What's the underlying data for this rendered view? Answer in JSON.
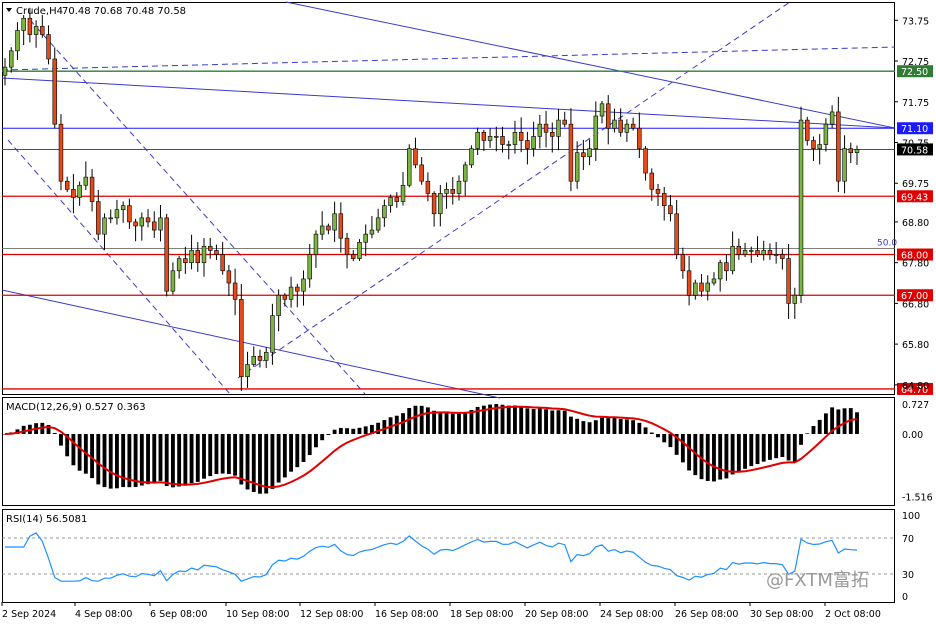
{
  "header": {
    "symbol_label": "Crude,H4",
    "ohlc_label": "70.48 70.68 70.48 70.58"
  },
  "macd_label": "MACD(12,26,9) 0.527 0.363",
  "rsi_label": "RSI(14) 56.5081",
  "watermark": "@FXTM富拓",
  "colors": {
    "bull": "#7cb342",
    "bear": "#e64a19",
    "support_resistance": "#e00000",
    "green_level": "#2e7d32",
    "blue_level": "#1a1aff",
    "trend": "#3a3acc",
    "macd_hist": "#000000",
    "macd_signal": "#e00000",
    "rsi": "#1e90ff"
  },
  "chart_data": [
    {
      "type": "candlestick",
      "price_ticks": [
        "73.75",
        "72.75",
        "71.75",
        "70.75",
        "69.75",
        "68.80",
        "67.80",
        "66.80",
        "65.80",
        "64.80"
      ],
      "ylim": [
        64.6,
        74.15
      ],
      "x_ticks": [
        "2 Sep 2024",
        "4 Sep 08:00",
        "6 Sep 08:00",
        "10 Sep 08:00",
        "12 Sep 08:00",
        "16 Sep 08:00",
        "18 Sep 08:00",
        "20 Sep 08:00",
        "24 Sep 08:00",
        "26 Sep 08:00",
        "30 Sep 08:00",
        "2 Oct 08:00"
      ],
      "horizontal_levels": [
        {
          "label": "72.50",
          "value": 72.5,
          "kind": "green"
        },
        {
          "label": "71.10",
          "value": 71.1,
          "kind": "blue"
        },
        {
          "label": "70.58",
          "value": 70.58,
          "kind": "current"
        },
        {
          "label": "69.43",
          "value": 69.43,
          "kind": "red"
        },
        {
          "label": "68.00",
          "value": 68.0,
          "kind": "red"
        },
        {
          "label": "67.00",
          "value": 67.0,
          "kind": "red"
        },
        {
          "label": "64.70",
          "value": 64.7,
          "kind": "red"
        }
      ],
      "fib_label": "50.0",
      "fib_value": 68.15,
      "closes": [
        72.6,
        73.0,
        73.5,
        73.8,
        73.4,
        73.6,
        73.4,
        72.8,
        71.2,
        69.8,
        69.6,
        69.4,
        69.7,
        69.9,
        69.3,
        68.5,
        68.9,
        68.9,
        69.1,
        69.2,
        68.8,
        68.7,
        68.9,
        68.8,
        68.6,
        68.9,
        67.1,
        67.6,
        67.9,
        67.8,
        68.1,
        67.8,
        68.2,
        68.1,
        68.0,
        67.6,
        67.3,
        66.9,
        65.0,
        65.3,
        65.5,
        65.4,
        65.6,
        66.5,
        67.0,
        66.9,
        67.2,
        67.1,
        67.4,
        68.0,
        68.5,
        68.7,
        68.6,
        69.0,
        68.4,
        68.0,
        67.9,
        68.3,
        68.5,
        68.6,
        68.9,
        69.2,
        69.4,
        69.3,
        69.7,
        70.6,
        70.2,
        69.8,
        69.5,
        69.0,
        69.5,
        69.6,
        69.5,
        69.8,
        70.2,
        70.6,
        71.0,
        70.8,
        70.9,
        70.9,
        70.7,
        70.7,
        71.0,
        70.8,
        70.6,
        70.9,
        71.2,
        71.0,
        70.9,
        71.3,
        71.2,
        69.8,
        70.5,
        70.4,
        70.6,
        71.4,
        71.7,
        71.1,
        71.3,
        71.0,
        71.2,
        71.1,
        70.6,
        70.0,
        69.6,
        69.5,
        69.2,
        69.0,
        68.0,
        67.6,
        67.0,
        67.3,
        67.1,
        67.3,
        67.4,
        67.8,
        67.6,
        68.2,
        68.0,
        68.1,
        68.1,
        68.0,
        68.1,
        68.0,
        68.0,
        67.9,
        66.8,
        67.0,
        71.3,
        70.8,
        70.6,
        70.7,
        71.2,
        71.5,
        69.8,
        70.6,
        70.5,
        70.58
      ],
      "trendlines_note": "descending channel, ascending channel, long-term downtrend lines"
    },
    {
      "type": "histogram+line",
      "name": "MACD(12,26,9)",
      "y_ticks": [
        "0.727",
        "0.00",
        "-1.516"
      ],
      "ylim": [
        -1.7,
        0.85
      ],
      "last_values": {
        "macd": 0.527,
        "signal": 0.363
      }
    },
    {
      "type": "line",
      "name": "RSI(14)",
      "y_ticks": [
        "100",
        "70",
        "30",
        "0"
      ],
      "ylim": [
        0,
        100
      ],
      "levels": [
        70,
        30
      ],
      "last_value": 56.5081
    }
  ]
}
